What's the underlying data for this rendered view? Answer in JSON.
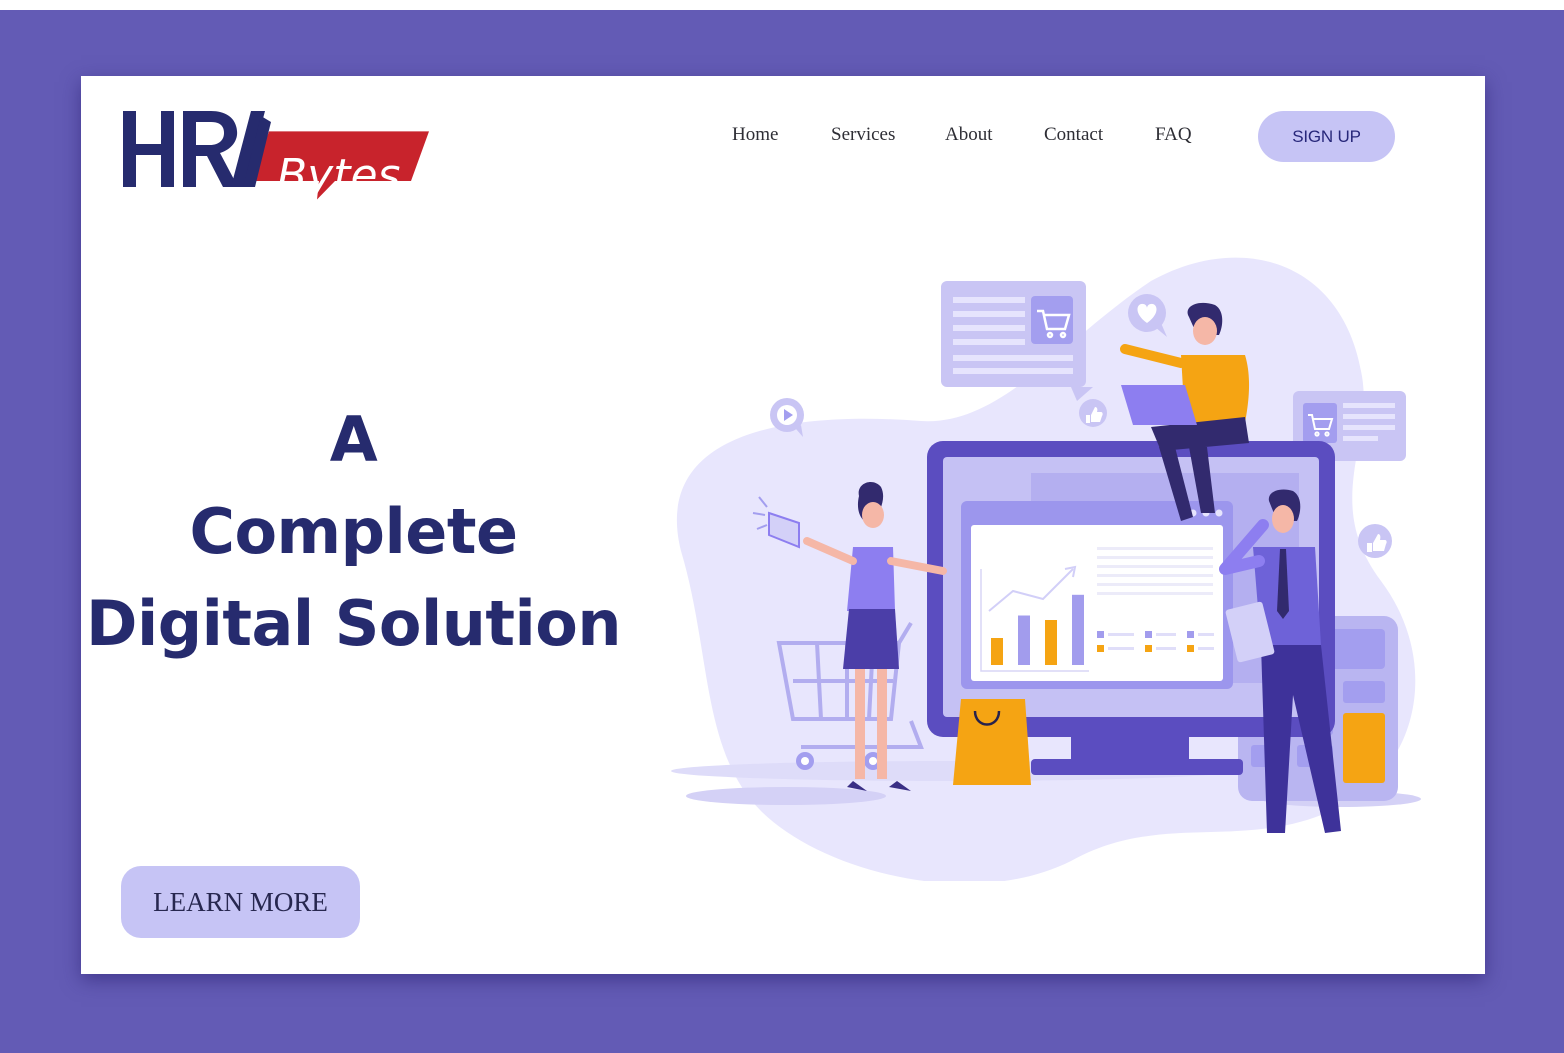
{
  "brand": {
    "logo_letters": "HR",
    "logo_word": "Bytes",
    "colors": {
      "navy": "#262b6e",
      "red": "#c8232c"
    }
  },
  "nav": {
    "items": [
      "Home",
      "Services",
      "About",
      "Contact",
      "FAQ"
    ],
    "signup_label": "SIGN UP"
  },
  "hero": {
    "headline_lines": [
      "A",
      "Complete",
      "Digital Solution"
    ],
    "cta_label": "LEARN MORE"
  },
  "theme": {
    "frame_color": "#635bb5",
    "button_color": "#c6c4f5",
    "headline_color": "#262b6e",
    "accent_orange": "#f5a413"
  },
  "illustration": {
    "icons": [
      "shopping-cart-icon",
      "heart-icon",
      "play-icon",
      "thumbs-up-icon",
      "megaphone-icon",
      "calculator-icon",
      "shopping-bag-icon",
      "trend-arrow-icon"
    ],
    "chart_bars": [
      {
        "value": 0.3,
        "color": "#f5a413"
      },
      {
        "value": 0.55,
        "color": "#a29ced"
      },
      {
        "value": 0.5,
        "color": "#f5a413"
      },
      {
        "value": 0.78,
        "color": "#a29ced"
      }
    ]
  }
}
